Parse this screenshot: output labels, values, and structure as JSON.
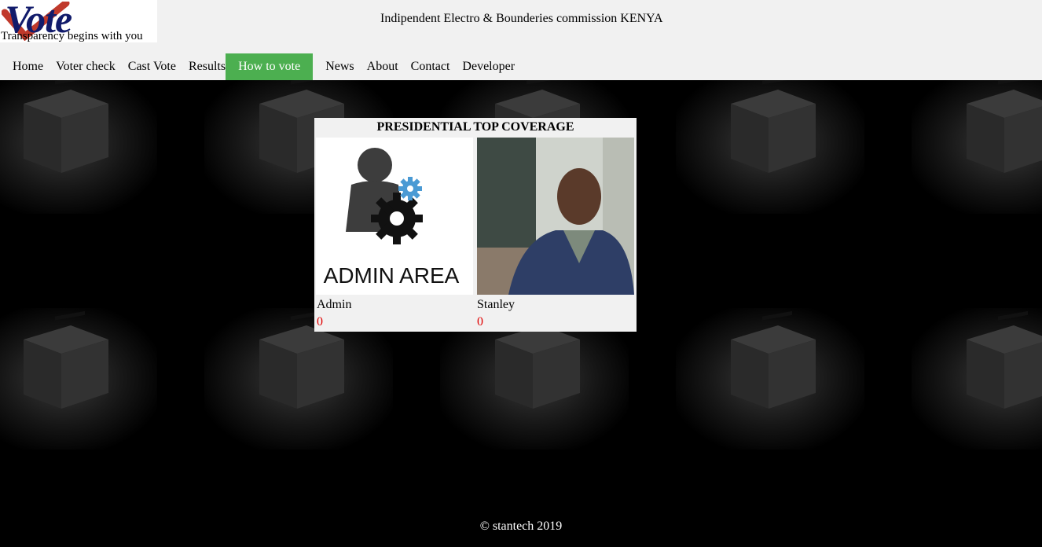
{
  "logo": {
    "word": "Vote",
    "tagline": "Transparency begins with you"
  },
  "header": {
    "commission": "Indipendent Electro & Bounderies commission KENYA"
  },
  "nav": {
    "items": [
      {
        "label": "Home"
      },
      {
        "label": "Voter check"
      },
      {
        "label": "Cast Vote"
      },
      {
        "label": "Results"
      },
      {
        "label": "How to vote",
        "active": true
      },
      {
        "label": "News"
      },
      {
        "label": "About"
      },
      {
        "label": "Contact"
      },
      {
        "label": "Developer"
      }
    ],
    "active_color": "#4caf50"
  },
  "coverage": {
    "title": "PRESIDENTIAL TOP COVERAGE",
    "admin_image_text": "ADMIN AREA",
    "candidates": [
      {
        "name": "Admin",
        "votes": "0"
      },
      {
        "name": "Stanley",
        "votes": "0"
      }
    ],
    "votes_color": "#e00000"
  },
  "footer": {
    "text": "© stantech 2019"
  }
}
